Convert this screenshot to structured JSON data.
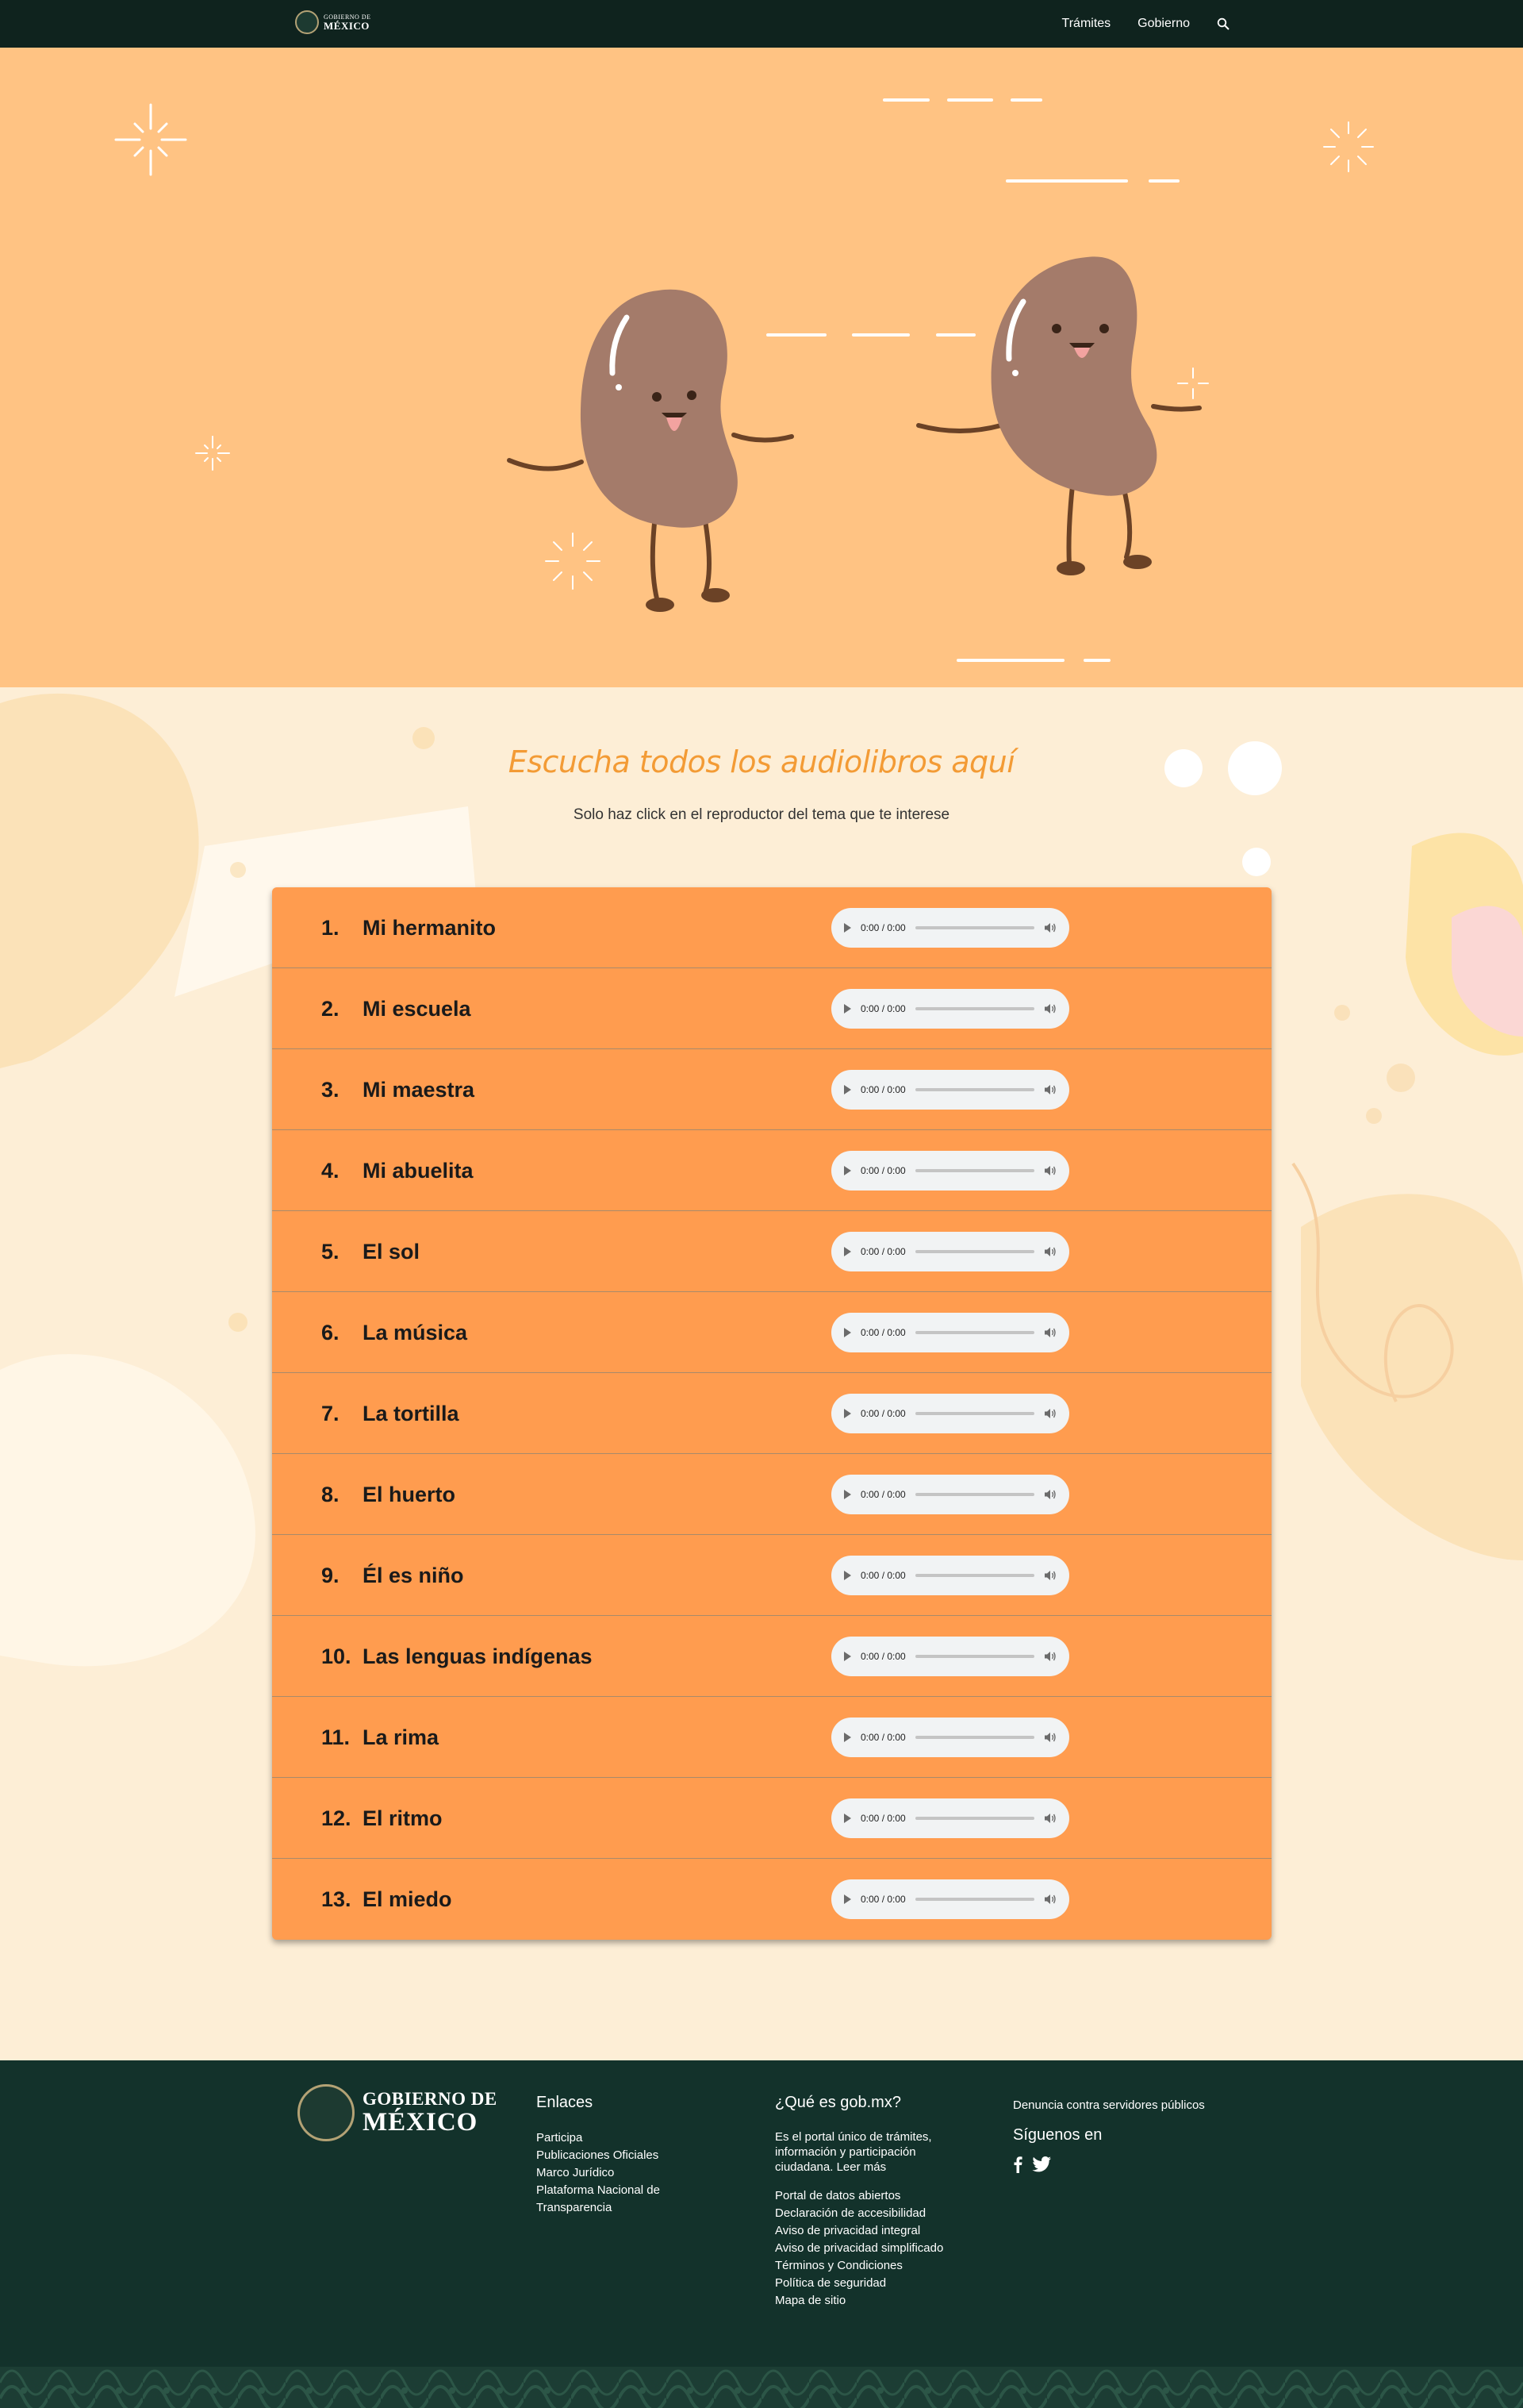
{
  "nav": {
    "logo_line1": "GOBIERNO DE",
    "logo_line2": "MÉXICO",
    "links": [
      "Trámites",
      "Gobierno"
    ]
  },
  "section": {
    "title": "Escucha todos los audiolibros aquí",
    "subtitle": "Solo haz click en el reproductor del tema que te interese"
  },
  "audiobooks": [
    {
      "num": "1.",
      "title": "Mi hermanito",
      "time": "0:00 / 0:00"
    },
    {
      "num": "2.",
      "title": "Mi escuela",
      "time": "0:00 / 0:00"
    },
    {
      "num": "3.",
      "title": "Mi maestra",
      "time": "0:00 / 0:00"
    },
    {
      "num": "4.",
      "title": "Mi abuelita",
      "time": "0:00 / 0:00"
    },
    {
      "num": "5.",
      "title": "El sol",
      "time": "0:00 / 0:00"
    },
    {
      "num": "6.",
      "title": "La música",
      "time": "0:00 / 0:00"
    },
    {
      "num": "7.",
      "title": "La tortilla",
      "time": "0:00 / 0:00"
    },
    {
      "num": "8.",
      "title": "El huerto",
      "time": "0:00 / 0:00"
    },
    {
      "num": "9.",
      "title": "Él es niño",
      "time": "0:00 / 0:00"
    },
    {
      "num": "10.",
      "title": "Las lenguas indígenas",
      "time": "0:00 / 0:00"
    },
    {
      "num": "11.",
      "title": "La rima",
      "time": "0:00 / 0:00"
    },
    {
      "num": "12.",
      "title": "El ritmo",
      "time": "0:00 / 0:00"
    },
    {
      "num": "13.",
      "title": "El miedo",
      "time": "0:00 / 0:00"
    }
  ],
  "footer": {
    "logo_line1": "GOBIERNO DE",
    "logo_line2": "MÉXICO",
    "enlaces_title": "Enlaces",
    "enlaces": [
      "Participa",
      "Publicaciones Oficiales",
      "Marco Jurídico",
      "Plataforma Nacional de",
      "Transparencia"
    ],
    "que_es_title": "¿Qué es gob.mx?",
    "que_es_text": [
      "Es el portal único de trámites,",
      "información y participación",
      "ciudadana. Leer más"
    ],
    "portal_links": [
      "Portal de datos abiertos",
      "Declaración de accesibilidad",
      "Aviso de privacidad integral",
      "Aviso de privacidad simplificado",
      "Términos y Condiciones",
      "Política de seguridad",
      "Mapa de sitio"
    ],
    "denuncia": "Denuncia contra servidores públicos",
    "siguenos": "Síguenos en"
  },
  "colors": {
    "navbar": "#0f231e",
    "hero_bg": "#ffc383",
    "content_bg": "#fdeed6",
    "list_bg": "#ff9c4f",
    "title_accent": "#f39b35",
    "footer_bg": "#13322b",
    "bean": "#a47b6a"
  },
  "icons": {
    "search": "search-icon",
    "play": "play-icon",
    "volume": "volume-icon",
    "facebook": "facebook-icon",
    "twitter": "twitter-icon"
  }
}
